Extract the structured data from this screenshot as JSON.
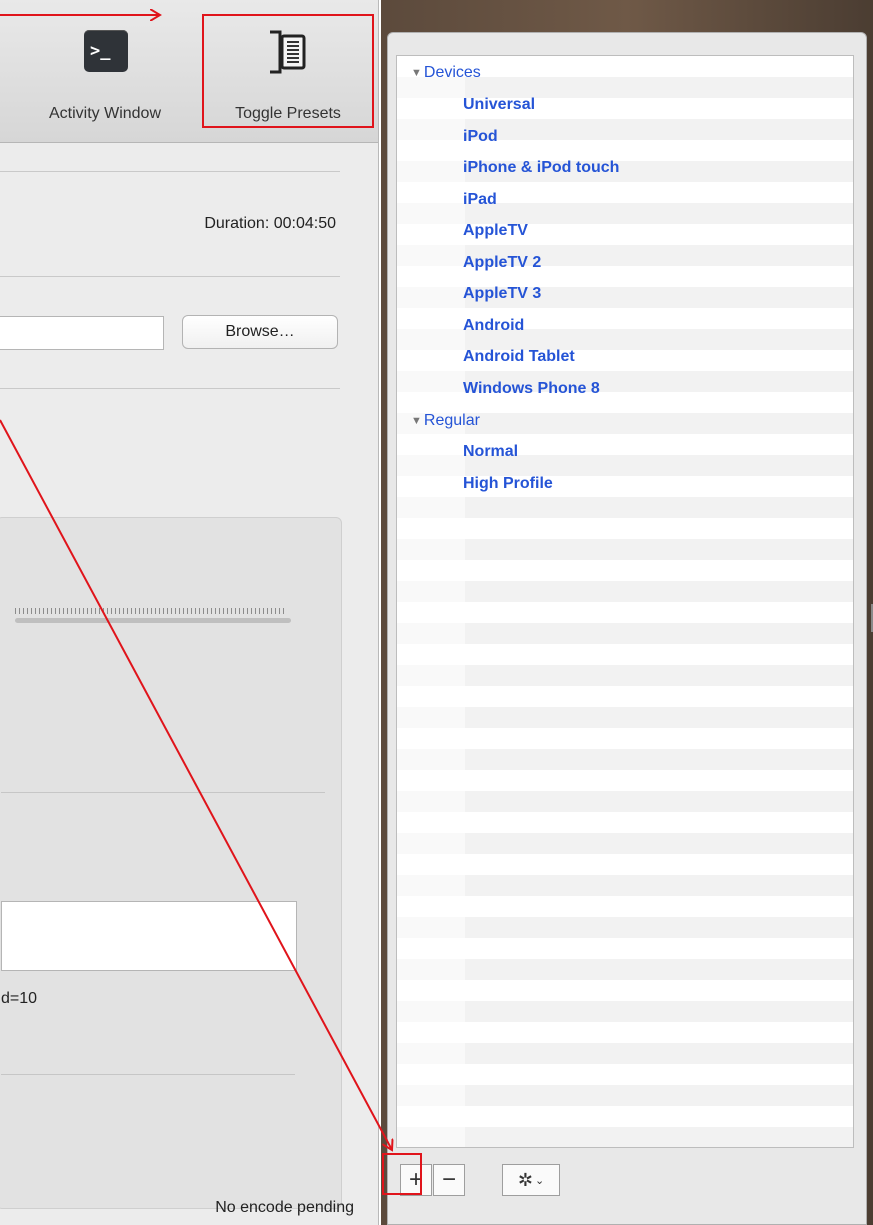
{
  "toolbar": {
    "activity_window": {
      "label": "Activity Window",
      "icon": "terminal-icon",
      "icon_glyph": ">_"
    },
    "toggle_presets": {
      "label": "Toggle Presets",
      "icon": "presets-drawer-icon"
    }
  },
  "source": {
    "duration": "Duration: 00:04:50"
  },
  "destination": {
    "browse_label": "Browse…",
    "file_value": ""
  },
  "advanced": {
    "options_text": "d=10",
    "options_field_value": ""
  },
  "status": {
    "text": "No encode pending"
  },
  "presets": {
    "groups": [
      {
        "label": "Devices",
        "items": [
          "Universal",
          "iPod",
          "iPhone & iPod touch",
          "iPad",
          "AppleTV",
          "AppleTV 2",
          "AppleTV 3",
          "Android",
          "Android Tablet",
          "Windows Phone 8"
        ]
      },
      {
        "label": "Regular",
        "items": [
          "Normal",
          "High Profile"
        ]
      }
    ],
    "default_preset": "Normal",
    "add_label": "+",
    "remove_label": "−",
    "gear_icon": "gear-icon",
    "chevron_glyph": "⌄",
    "link_color": "#2554d6"
  },
  "annotation": {
    "color": "#e0141b"
  }
}
